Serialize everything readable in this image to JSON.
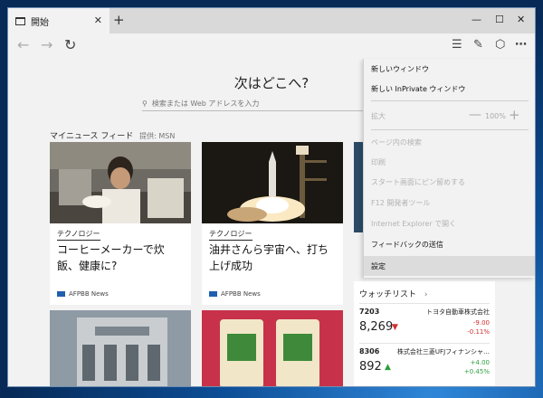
{
  "tab": {
    "title": "開始"
  },
  "page": {
    "heading": "次はどこへ?",
    "search_placeholder": "検索または Web アドレスを入力",
    "feed_title": "マイニュース フィード",
    "feed_source": "提供: MSN"
  },
  "cards": [
    {
      "category": "テクノロジー",
      "title": "コーヒーメーカーで炊飯、健康に?",
      "source": "AFPBB News"
    },
    {
      "category": "テクノロジー",
      "title": "油井さんら宇宙へ、打ち上げ成功",
      "source": "AFPBB News"
    }
  ],
  "watchlist": {
    "title": "ウォッチリスト",
    "stocks": [
      {
        "code": "7203",
        "name": "トヨタ自動車株式会社",
        "price": "8,269",
        "change": "-9.00",
        "percent": "-0.11%",
        "direction": "down"
      },
      {
        "code": "8306",
        "name": "株式会社三菱UFJフィナンシャ…",
        "price": "892",
        "change": "+4.00",
        "percent": "+0.45%",
        "direction": "up"
      }
    ]
  },
  "menu": {
    "new_window": "新しいウィンドウ",
    "new_inprivate": "新しい InPrivate ウィンドウ",
    "zoom_label": "拡大",
    "zoom_value": "100%",
    "find": "ページ内の検索",
    "print": "印刷",
    "pin": "スタート画面にピン留めする",
    "devtools": "F12 開発者ツール",
    "open_ie": "Internet Explorer で開く",
    "feedback": "フィードバックの送信",
    "settings": "設定"
  },
  "colors": {
    "down": "#d32f2f",
    "up": "#2e9e3e",
    "accent": "#1f5fae"
  }
}
